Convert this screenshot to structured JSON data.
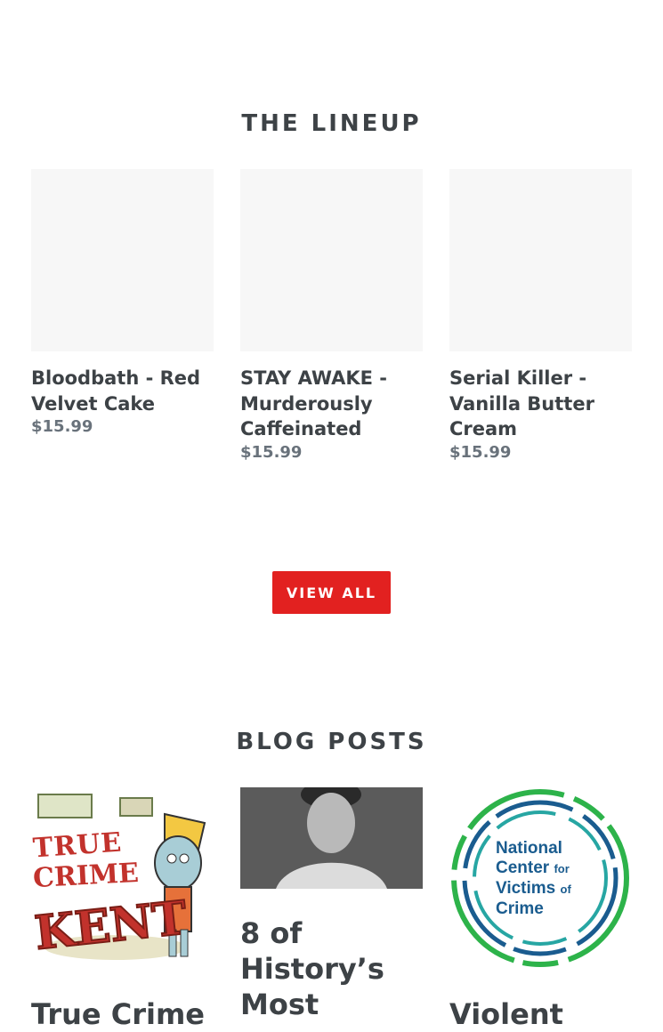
{
  "lineup": {
    "title": "THE LINEUP",
    "products": [
      {
        "name": "Bloodbath - Red Velvet Cake",
        "price": "$15.99"
      },
      {
        "name": "STAY AWAKE - Murderously Caffeinated",
        "price": "$15.99"
      },
      {
        "name": "Serial Killer - Vanilla Butter Cream",
        "price": "$15.99"
      }
    ],
    "view_all_label": "VIEW ALL"
  },
  "blog": {
    "title": "BLOG POSTS",
    "posts": [
      {
        "title": "True Crime",
        "image_text": [
          "TRUE",
          "CRIME",
          "KENT"
        ]
      },
      {
        "title": "8 of History’s Most"
      },
      {
        "title": "Violent",
        "image_text": [
          "National",
          "Center",
          "for",
          "Victims",
          "of",
          "Crime"
        ]
      }
    ]
  },
  "colors": {
    "accent": "#e22120",
    "text": "#3d4246",
    "price": "#69727b",
    "ncvc_blue": "#1a5c8f",
    "ncvc_green": "#2db34a"
  }
}
